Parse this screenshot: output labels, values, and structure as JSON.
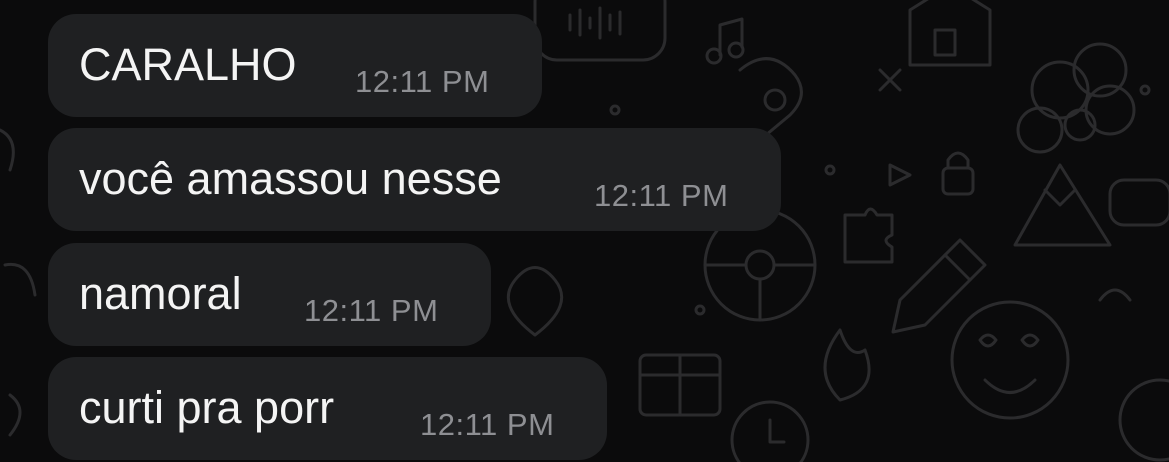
{
  "messages": [
    {
      "text": "CARALHO",
      "time": "12:11 PM"
    },
    {
      "text": "você amassou nesse",
      "time": "12:11 PM"
    },
    {
      "text": "namoral",
      "time": "12:11 PM"
    },
    {
      "text": "curti pra porr",
      "time": "12:11 PM"
    }
  ],
  "colors": {
    "background": "#0b0b0c",
    "bubble": "#1f2022",
    "message_text": "#f4f4f4",
    "timestamp": "#8e8f93",
    "doodle": "#2a2a2c"
  }
}
